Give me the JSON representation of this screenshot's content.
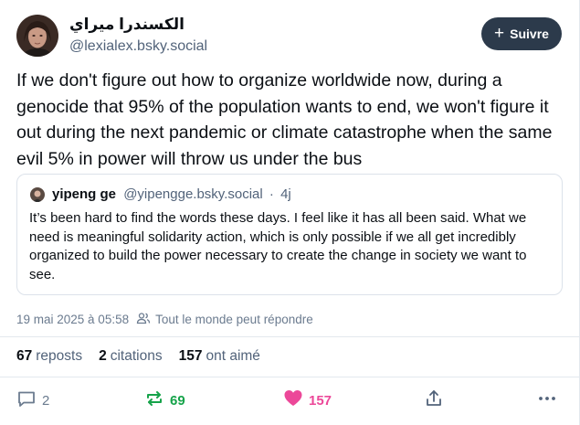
{
  "author": {
    "display_name": "الكسندرا ميراي",
    "handle": "@lexialex.bsky.social",
    "avatar_icon": "author-avatar"
  },
  "follow_button": {
    "label": "Suivre",
    "icon": "plus-icon"
  },
  "post": {
    "text": "If we don't figure out how to organize worldwide now, during a genocide that 95% of the population wants to end, we won't figure it out during the next pandemic or climate catastrophe when the same evil 5% in power will throw us under the bus"
  },
  "quote": {
    "display_name": "yipeng ge",
    "handle": "@yipengge.bsky.social",
    "separator": "·",
    "time": "4j",
    "text": "It’s been hard to find the words these days. I feel like it has all been said. What we need is meaningful solidarity action, which is only possible if we all get incredibly organized to build the power necessary to create the change in society we want to see."
  },
  "meta": {
    "timestamp": "19 mai 2025 à 05:58",
    "reply_setting": "Tout le monde peut répondre"
  },
  "stats": {
    "reposts_count": "67",
    "reposts_label": "reposts",
    "quotes_count": "2",
    "quotes_label": "citations",
    "likes_count": "157",
    "likes_label": "ont aimé"
  },
  "actions": {
    "reply_count": "2",
    "repost_count": "69",
    "like_count": "157"
  },
  "colors": {
    "repost_active": "#16a34a",
    "like_active": "#ec4899",
    "follow_bg": "#2c3a4b",
    "muted": "#52637a"
  }
}
